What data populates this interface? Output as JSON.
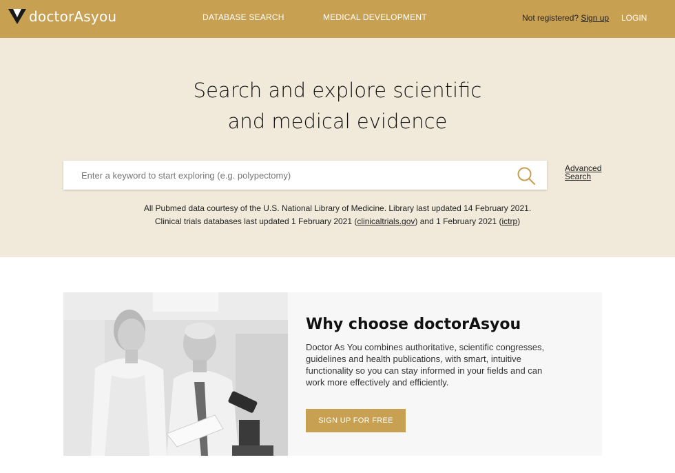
{
  "header": {
    "logo_text": "doctorAsyou",
    "nav": {
      "database_search": "DATABASE SEARCH",
      "medical_development": "MEDICAL DEVELOPMENT"
    },
    "not_registered": "Not registered?",
    "sign_up": "Sign up",
    "login": "LOGIN"
  },
  "hero": {
    "title_line1": "Search and explore scientific",
    "title_line2": "and medical evidence",
    "search": {
      "placeholder": "Enter a keyword to start exploring (e.g. polypectomy)",
      "icon": "search-icon"
    },
    "advanced_search": "Advanced Search",
    "notice_line1": "All Pubmed data courtesy of the U.S. National Library of Medicine. Library last updated 14 February 2021.",
    "notice_line2_a": "Clinical trials databases last updated 1 February 2021 (",
    "clinicaltrials_link": "clinicaltrials.gov",
    "notice_line2_b": ") and 1 February 2021 (",
    "ictrp_link": "ictrp",
    "notice_line2_c": ")"
  },
  "feature": {
    "title": "Why choose doctorAsyou",
    "body": "Doctor As You combines authoritative, scientific congresses, guidelines and health publications, with smart, intuitive functionality so you can stay informed in your fields and can work more effectively and efficiently.",
    "cta": "SIGN UP FOR FREE"
  },
  "colors": {
    "brand_gold": "#c8a052",
    "hero_bg": "#f1e9da"
  }
}
